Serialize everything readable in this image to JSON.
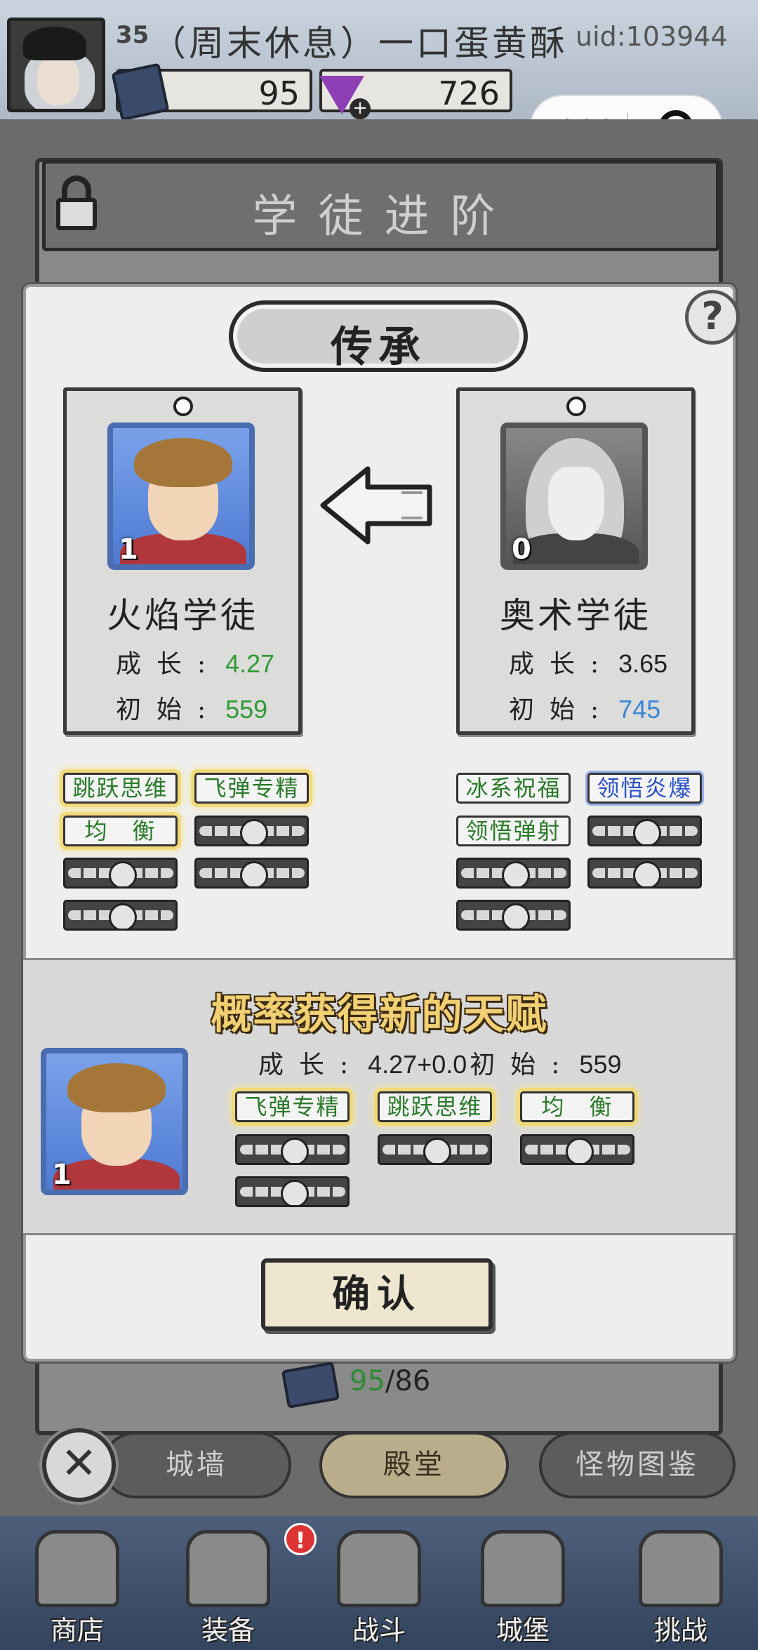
{
  "player": {
    "level": "35",
    "name": "（周末休息）一口蛋黄酥",
    "uid": "uid:103944",
    "books": "95",
    "gems": "726",
    "gem_plus": "+"
  },
  "wechat_capsule": {
    "more": "•••"
  },
  "panel": {
    "title": "学徒进阶"
  },
  "dialog": {
    "title": "传承",
    "help": "?",
    "left_card": {
      "level": "1",
      "name": "火焰学徒",
      "growth_label": "成长:",
      "growth_value": "4.27",
      "initial_label": "初始:",
      "initial_value": "559",
      "talents": [
        "跳跃思维",
        "飞弹专精",
        "均　衡"
      ]
    },
    "right_card": {
      "level": "0",
      "name": "奥术学徒",
      "growth_label": "成长:",
      "growth_value": "3.65",
      "initial_label": "初始:",
      "initial_value": "745",
      "talents": [
        "冰系祝福",
        "领悟炎爆",
        "领悟弹射"
      ]
    },
    "result": {
      "title": "概率获得新的天赋",
      "level": "1",
      "growth_label": "成长:",
      "growth_value": "4.27+0.0",
      "initial_label": "初始:",
      "initial_value": "559",
      "talents": [
        "飞弹专精",
        "跳跃思维",
        "均　衡"
      ]
    },
    "confirm": "确认"
  },
  "book_counter": {
    "have": "95",
    "need": "/86"
  },
  "tabs": [
    "城墙",
    "殿堂",
    "怪物图鉴"
  ],
  "close": "✕",
  "bottom_nav": [
    {
      "label": "商店"
    },
    {
      "label": "装备"
    },
    {
      "label": "战斗"
    },
    {
      "label": "城堡"
    },
    {
      "label": "挑战"
    }
  ],
  "badge": "!",
  "colors": {
    "growth_good": "#2f9b36",
    "initial_better": "#3a86d8",
    "talent_glow": "#f1d97a"
  }
}
